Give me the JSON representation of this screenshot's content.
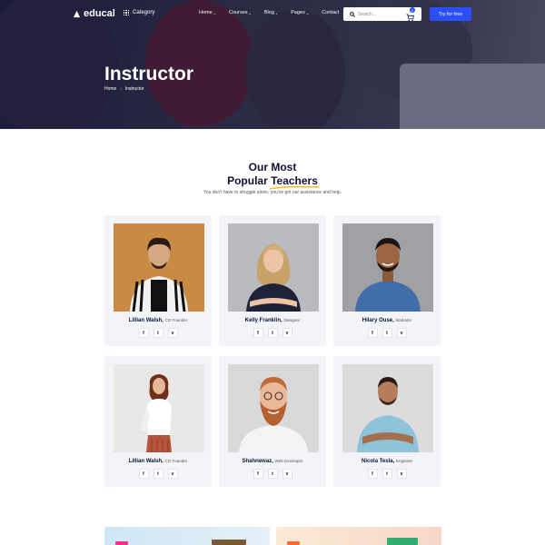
{
  "header": {
    "logo": "educal",
    "category": "Category",
    "menu": [
      {
        "label": "Home",
        "caret": "⌄"
      },
      {
        "label": "Courses",
        "caret": "⌄"
      },
      {
        "label": "Blog",
        "caret": "⌄"
      },
      {
        "label": "Pages",
        "caret": "⌄"
      },
      {
        "label": "Contact",
        "caret": ""
      }
    ],
    "search_placeholder": "Search...",
    "cart_count": "2",
    "cta": "Try for free"
  },
  "hero": {
    "title": "Instructor",
    "breadcrumb": {
      "home": "Home",
      "sep": "›",
      "current": "Instructor"
    }
  },
  "section": {
    "title_line1": "Our Most",
    "title_line2_prefix": "Popular ",
    "title_highlight": "Teachers",
    "subtitle": "You don't have to struggle alone, you've got our assistance and help."
  },
  "teachers": [
    {
      "name": "Lillian Walsh,",
      "role": "CO Founder"
    },
    {
      "name": "Kelly Franklin,",
      "role": "Designer"
    },
    {
      "name": "Hilary Ouse,",
      "role": "Markater"
    },
    {
      "name": "Lillian Walsh,",
      "role": "CO Founder"
    },
    {
      "name": "Shahnewaz,",
      "role": "Web Developer"
    },
    {
      "name": "Nicola Tesla,",
      "role": "Engineer"
    }
  ],
  "social_icons": [
    "f",
    "t",
    "v"
  ],
  "colors": {
    "accent": "#2b4eff",
    "highlight": "#ffb606",
    "card_bg": "#f3f4f8",
    "text": "#0e1133"
  }
}
